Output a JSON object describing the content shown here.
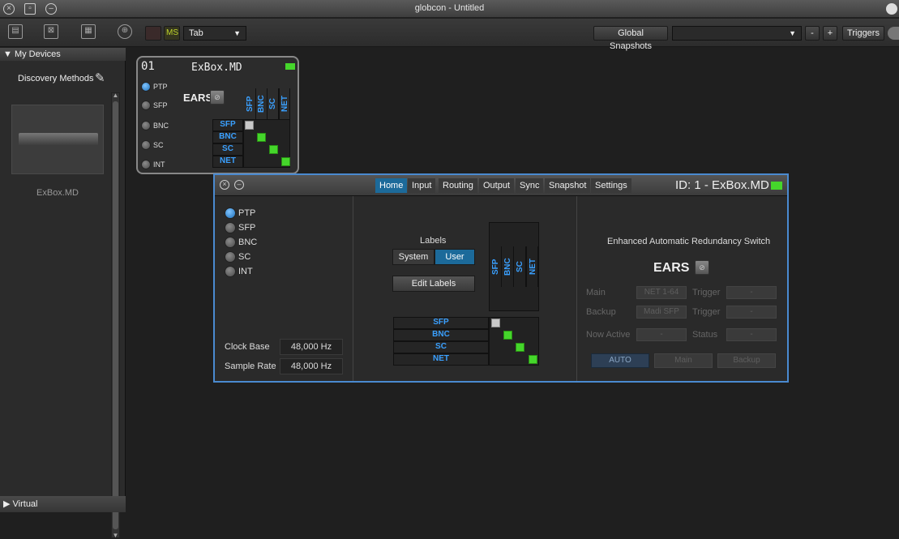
{
  "window": {
    "title": "globcon - Untitled"
  },
  "toolbar": {
    "tab_label": "Tab",
    "solo_label": "",
    "ms_label": "MS",
    "global_snapshots": "Global Snapshots",
    "snapshot_value": "",
    "minus": "-",
    "plus": "+",
    "triggers": "Triggers"
  },
  "sidebar": {
    "my_devices": "My Devices",
    "discovery": "Discovery Methods",
    "device_name": "ExBox.MD",
    "virtual": "Virtual"
  },
  "device_card": {
    "number": "01",
    "name": "ExBox.MD",
    "inputs": [
      "PTP",
      "SFP",
      "BNC",
      "SC",
      "INT"
    ],
    "ears": "EARS",
    "matrix_labels": [
      "SFP",
      "BNC",
      "SC",
      "NET"
    ]
  },
  "panel": {
    "tabs": [
      "Home",
      "Input",
      "Routing",
      "Output",
      "Sync",
      "Snapshot",
      "Settings"
    ],
    "id_label": "ID: 1 - ExBox.MD",
    "inputs": [
      "PTP",
      "SFP",
      "BNC",
      "SC",
      "INT"
    ],
    "clock_base_label": "Clock Base",
    "clock_base": "48,000 Hz",
    "sample_rate_label": "Sample Rate",
    "sample_rate": "48,000 Hz",
    "labels_title": "Labels",
    "system": "System",
    "user": "User",
    "edit_labels": "Edit Labels",
    "matrix_labels": [
      "SFP",
      "BNC",
      "SC",
      "NET"
    ],
    "ears_title": "Enhanced Automatic Redundancy Switch",
    "ears": "EARS",
    "main_label": "Main",
    "main_value": "NET 1-64",
    "trigger_label": "Trigger",
    "trigger_value": "-",
    "backup_label": "Backup",
    "backup_value": "Madi SFP",
    "trigger2_value": "-",
    "now_active_label": "Now Active",
    "now_active_value": "-",
    "status_label": "Status",
    "status_value": "-",
    "auto": "AUTO",
    "main_btn": "Main",
    "backup_btn": "Backup"
  },
  "colors": {
    "accent": "#1c6a9a",
    "label_blue": "#3aa0ff",
    "green": "#45d62b"
  }
}
